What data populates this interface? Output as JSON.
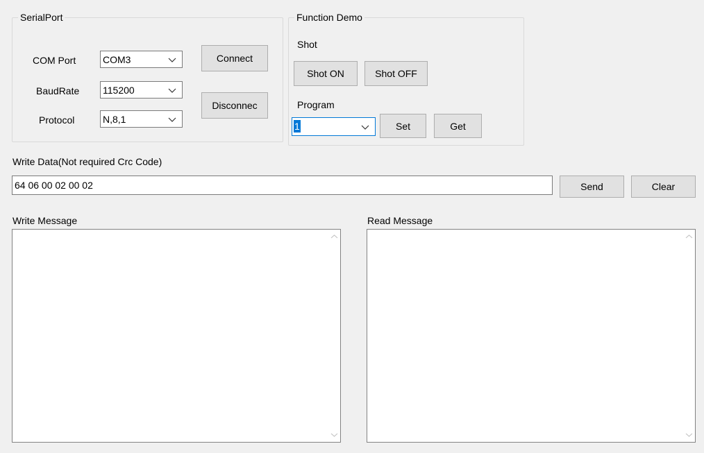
{
  "serial_port": {
    "title": "SerialPort",
    "com_port": {
      "label": "COM Port",
      "value": "COM3"
    },
    "baud_rate": {
      "label": "BaudRate",
      "value": "115200"
    },
    "protocol": {
      "label": "Protocol",
      "value": "N,8,1"
    },
    "connect_label": "Connect",
    "disconnect_label": "Disconnec"
  },
  "function_demo": {
    "title": "Function Demo",
    "shot": {
      "label": "Shot",
      "on_label": "Shot ON",
      "off_label": "Shot OFF"
    },
    "program": {
      "label": "Program",
      "value": "1",
      "set_label": "Set",
      "get_label": "Get"
    }
  },
  "write_data": {
    "label": "Write Data(Not required Crc Code)",
    "value": "64 06 00 02 00 02",
    "send_label": "Send",
    "clear_label": "Clear"
  },
  "write_message": {
    "label": "Write Message",
    "content": ""
  },
  "read_message": {
    "label": "Read Message",
    "content": ""
  },
  "icons": {
    "dropdown": "chevron-down-icon",
    "scroll_up": "scroll-up-arrow-icon",
    "scroll_down": "scroll-down-arrow-icon"
  }
}
